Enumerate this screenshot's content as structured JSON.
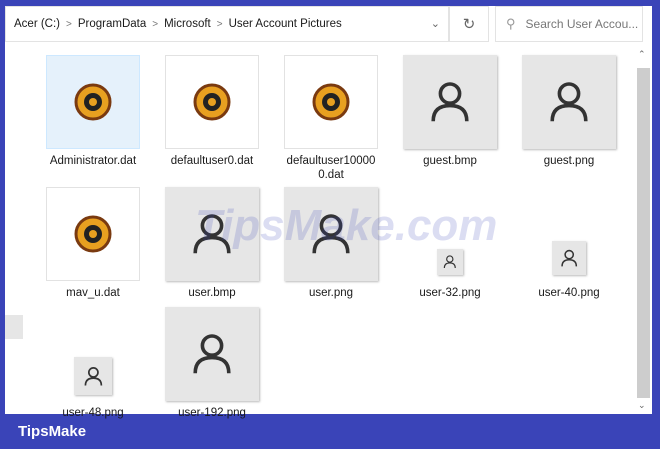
{
  "breadcrumb": [
    "Acer (C:)",
    "ProgramData",
    "Microsoft",
    "User Account Pictures"
  ],
  "search": {
    "placeholder": "Search User Accou..."
  },
  "files": [
    {
      "name": "Administrator.dat",
      "type": "dat",
      "selected": true
    },
    {
      "name": "defaultuser0.dat",
      "type": "dat"
    },
    {
      "name": "defaultuser10000\n0.dat",
      "type": "dat"
    },
    {
      "name": "guest.bmp",
      "type": "user"
    },
    {
      "name": "guest.png",
      "type": "user"
    },
    {
      "name": "mav_u.dat",
      "type": "dat"
    },
    {
      "name": "user.bmp",
      "type": "user"
    },
    {
      "name": "user.png",
      "type": "user"
    },
    {
      "name": "user-32.png",
      "type": "user-small"
    },
    {
      "name": "user-40.png",
      "type": "user-small"
    },
    {
      "name": "user-48.png",
      "type": "user-small"
    },
    {
      "name": "user-192.png",
      "type": "user"
    }
  ],
  "watermark": "TipsMake.com",
  "brand": "TipsMake"
}
